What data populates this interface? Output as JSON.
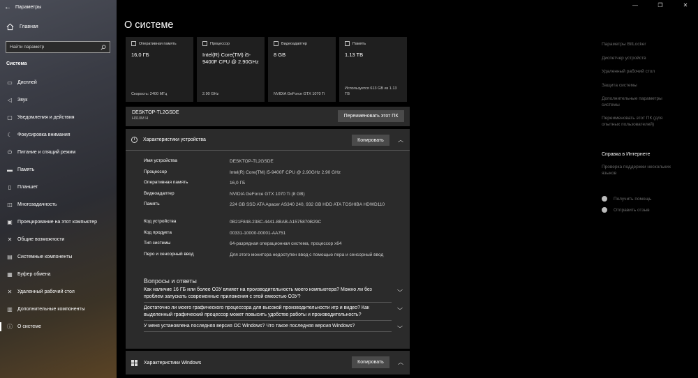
{
  "window": {
    "title": "Параметры",
    "minimize": "—",
    "maximize": "❐",
    "close": "✕"
  },
  "sidebar": {
    "home_label": "Главная",
    "search_placeholder": "Найти параметр",
    "section_title": "Система",
    "items": [
      {
        "label": "Дисплей",
        "icon": "display-icon",
        "glyph": "▭"
      },
      {
        "label": "Звук",
        "icon": "sound-icon",
        "glyph": "◁"
      },
      {
        "label": "Уведомления и действия",
        "icon": "notifications-icon",
        "glyph": "▢"
      },
      {
        "label": "Фокусировка внимания",
        "icon": "focus-assist-icon",
        "glyph": "☾"
      },
      {
        "label": "Питание и спящий режим",
        "icon": "power-icon",
        "glyph": "⏻"
      },
      {
        "label": "Память",
        "icon": "storage-icon",
        "glyph": "▬"
      },
      {
        "label": "Планшет",
        "icon": "tablet-icon",
        "glyph": "▯"
      },
      {
        "label": "Многозадачность",
        "icon": "multitasking-icon",
        "glyph": "◫"
      },
      {
        "label": "Проецирование на этот компьютер",
        "icon": "projecting-icon",
        "glyph": "▣"
      },
      {
        "label": "Общие возможности",
        "icon": "shared-experiences-icon",
        "glyph": "✕"
      },
      {
        "label": "Системные компоненты",
        "icon": "system-components-icon",
        "glyph": "▤"
      },
      {
        "label": "Буфер обмена",
        "icon": "clipboard-icon",
        "glyph": "▦"
      },
      {
        "label": "Удаленный рабочий стол",
        "icon": "remote-desktop-icon",
        "glyph": "✕"
      },
      {
        "label": "Дополнительные компоненты",
        "icon": "optional-features-icon",
        "glyph": "▥"
      },
      {
        "label": "О системе",
        "icon": "about-icon",
        "glyph": "ⓘ"
      }
    ]
  },
  "main": {
    "title": "О системе",
    "cards": [
      {
        "label": "Оперативная память",
        "value": "16,0 ГБ",
        "foot": "Скорость: 2400 МГц"
      },
      {
        "label": "Процессор",
        "value": "Intel(R) Core(TM) i5-9400F CPU @ 2.90GHz",
        "foot": "2.90 GHz"
      },
      {
        "label": "Видеоадаптер",
        "value": "8 GB",
        "foot": "NVIDIA GeForce GTX 1070 Ti"
      },
      {
        "label": "Память",
        "value": "1.13 TB",
        "foot": "Используется 613 GB из 1.13 TB"
      }
    ],
    "pc": {
      "name": "DESKTOP-TL2GSDE",
      "model": "H310M H",
      "rename_button": "Переименовать этот ПК"
    },
    "device_specs": {
      "title": "Характеристики устройства",
      "copy_button": "Копировать",
      "rows": [
        {
          "k": "Имя устройства",
          "v": "DESKTOP-TL2GSDE"
        },
        {
          "k": "Процессор",
          "v": "Intel(R) Core(TM) i5-9400F CPU @ 2.90GHz   2.90 GHz"
        },
        {
          "k": "Оперативная память",
          "v": "16,0 ГБ"
        },
        {
          "k": "Видеоадаптер",
          "v": "NVIDIA GeForce GTX 1070 Ti (8 GB)"
        },
        {
          "k": "Память",
          "v": "224 GB SSD ATA Apacer AS340 240, 932 GB HDD ATA TOSHIBA HDWD110"
        },
        {
          "k": "Код устройства",
          "v": "0B21F848-238C-4441-8BAB-A1575870B29C"
        },
        {
          "k": "Код продукта",
          "v": "00331-10000-00001-AA751"
        },
        {
          "k": "Тип системы",
          "v": "64-разрядная операционная система, процессор x64"
        },
        {
          "k": "Перо и сенсорный ввод",
          "v": "Для этого монитора недоступен ввод с помощью пера и сенсорный ввод"
        }
      ]
    },
    "qa": {
      "title": "Вопросы и ответы",
      "items": [
        "Как наличие 16 ГБ или более ОЗУ влияет на производительность моего компьютера? Можно ли без проблем запускать современные приложения с этой емкостью ОЗУ?",
        "Достаточно ли моего графического процессора для высокой производительности игр и видео? Как выделенный графический процессор может повысить удобство работы и производительность?",
        "У меня установлена последняя версия ОС Windows? Что такое последняя версия Windows?"
      ]
    },
    "windows_specs": {
      "title": "Характеристики Windows",
      "copy_button": "Копировать"
    }
  },
  "related": {
    "links": [
      "Параметры BitLocker",
      "Диспетчер устройств",
      "Удаленный рабочий стол",
      "Защита системы",
      "Дополнительные параметры системы",
      "Переименовать этот ПК (для опытных пользователей)"
    ],
    "help_title": "Справка в Интернете",
    "help_link": "Проверка поддержки нескольких языков",
    "get_help": "Получить помощь",
    "feedback": "Отправить отзыв"
  }
}
